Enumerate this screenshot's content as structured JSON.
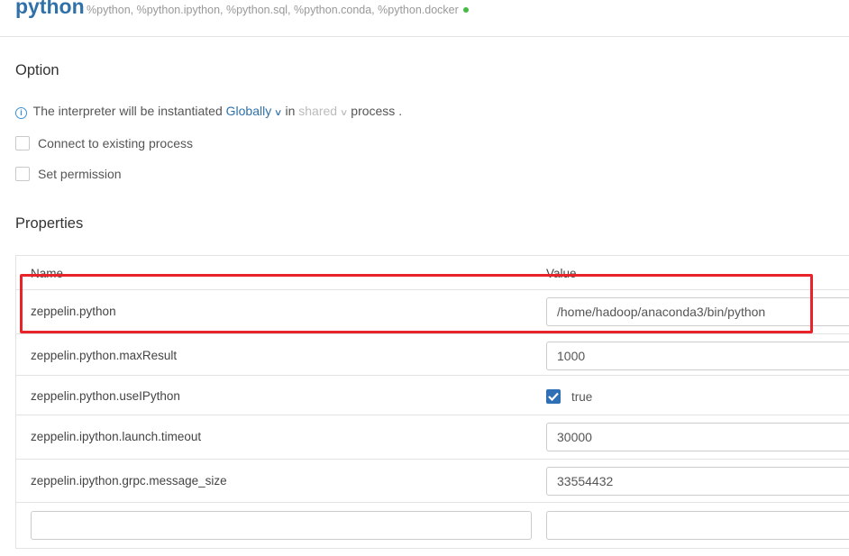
{
  "header": {
    "title": "python",
    "subtitle": "%python, %python.ipython, %python.sql, %python.conda, %python.docker",
    "status_color": "#44bb44"
  },
  "option": {
    "title": "Option",
    "info_icon": "info-circle-icon",
    "info_prefix": "The interpreter will be instantiated",
    "scope": "Globally",
    "in_word": "in",
    "process_mode": "shared",
    "info_suffix": "process .",
    "connect_existing": "Connect to existing process",
    "set_permission": "Set permission"
  },
  "properties": {
    "title": "Properties",
    "headers": {
      "name": "Name",
      "value": "Value"
    },
    "rows": [
      {
        "name": "zeppelin.python",
        "value": "/home/hadoop/anaconda3/bin/python"
      },
      {
        "name": "zeppelin.python.maxResult",
        "value": "1000"
      },
      {
        "name": "zeppelin.python.useIPython",
        "value": "true",
        "type": "checkbox",
        "checked": true
      },
      {
        "name": "zeppelin.ipython.launch.timeout",
        "value": "30000"
      },
      {
        "name": "zeppelin.ipython.grpc.message_size",
        "value": "33554432"
      }
    ],
    "new_row": {
      "name": "",
      "value": ""
    }
  },
  "colors": {
    "accent": "#3071a9",
    "checkbox": "#2f6fb5",
    "highlight": "#e8242a"
  }
}
